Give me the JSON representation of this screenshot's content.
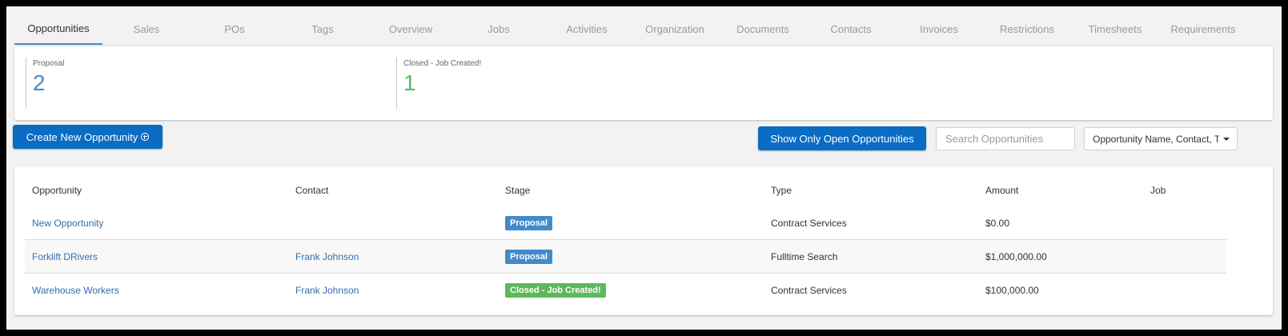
{
  "tabs": [
    {
      "label": "Opportunities",
      "active": true
    },
    {
      "label": "Sales"
    },
    {
      "label": "POs"
    },
    {
      "label": "Tags"
    },
    {
      "label": "Overview"
    },
    {
      "label": "Jobs"
    },
    {
      "label": "Activities"
    },
    {
      "label": "Organization"
    },
    {
      "label": "Documents"
    },
    {
      "label": "Contacts"
    },
    {
      "label": "Invoices"
    },
    {
      "label": "Restrictions"
    },
    {
      "label": "Timesheets"
    },
    {
      "label": "Requirements"
    }
  ],
  "summary": {
    "proposal": {
      "label": "Proposal",
      "count": "2",
      "color": "#4a8bc9"
    },
    "closed": {
      "label": "Closed - Job Created!",
      "count": "1",
      "color": "#5cb85c"
    }
  },
  "toolbar": {
    "create_label": "Create New Opportunity",
    "create_icon": "circle-plus-icon",
    "show_open_label": "Show Only Open Opportunities",
    "search_placeholder": "Search Opportunities",
    "filter_selected": "Opportunity Name, Contact, Type",
    "accent_color": "#0b6cc3"
  },
  "table": {
    "headers": [
      "Opportunity",
      "Contact",
      "Stage",
      "Type",
      "Amount",
      "Job"
    ],
    "rows": [
      {
        "opportunity": "New Opportunity",
        "contact": "",
        "stage": "Proposal",
        "stage_color": "#428bca",
        "type": "Contract Services",
        "amount": "$0.00",
        "job": ""
      },
      {
        "opportunity": "Forklift DRivers",
        "contact": "Frank Johnson",
        "stage": "Proposal",
        "stage_color": "#428bca",
        "type": "Fulltime Search",
        "amount": "$1,000,000.00",
        "job": ""
      },
      {
        "opportunity": "Warehouse Workers",
        "contact": "Frank Johnson",
        "stage": "Closed - Job Created!",
        "stage_color": "#5cb85c",
        "type": "Contract Services",
        "amount": "$100,000.00",
        "job": ""
      }
    ]
  }
}
